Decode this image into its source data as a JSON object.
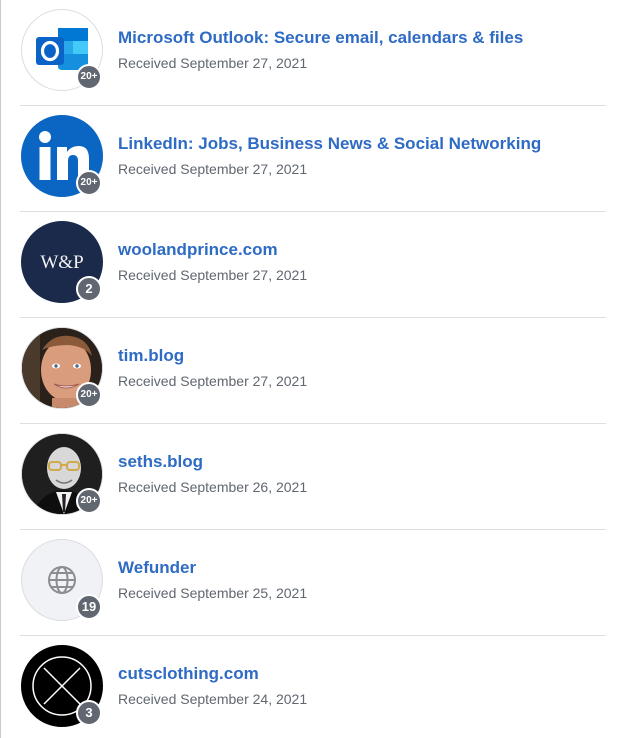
{
  "subscriptions": [
    {
      "title": "Microsoft Outlook: Secure email, calendars & files",
      "received": "Received September 27, 2021",
      "count": "20+",
      "icon": "outlook-logo-icon",
      "accent": "#0a64c8"
    },
    {
      "title": "LinkedIn: Jobs, Business News & Social Networking",
      "received": "Received September 27, 2021",
      "count": "20+",
      "icon": "linkedin-logo-icon",
      "accent": "#0a66c2"
    },
    {
      "title": "woolandprince.com",
      "received": "Received September 27, 2021",
      "count": "2",
      "icon": "wool-and-prince-logo-icon",
      "logo_text": "W&P",
      "accent": "#1b2a4a"
    },
    {
      "title": "tim.blog",
      "received": "Received September 27, 2021",
      "count": "20+",
      "icon": "person-photo-avatar"
    },
    {
      "title": "seths.blog",
      "received": "Received September 26, 2021",
      "count": "20+",
      "icon": "person-photo-avatar"
    },
    {
      "title": "Wefunder",
      "received": "Received September 25, 2021",
      "count": "19",
      "icon": "globe-icon"
    },
    {
      "title": "cutsclothing.com",
      "received": "Received September 24, 2021",
      "count": "3",
      "icon": "cuts-clothing-logo-icon"
    }
  ],
  "colors": {
    "link": "#2e6bc4",
    "secondary_text": "#606770",
    "badge": "#606770",
    "divider": "#dddfe2"
  }
}
